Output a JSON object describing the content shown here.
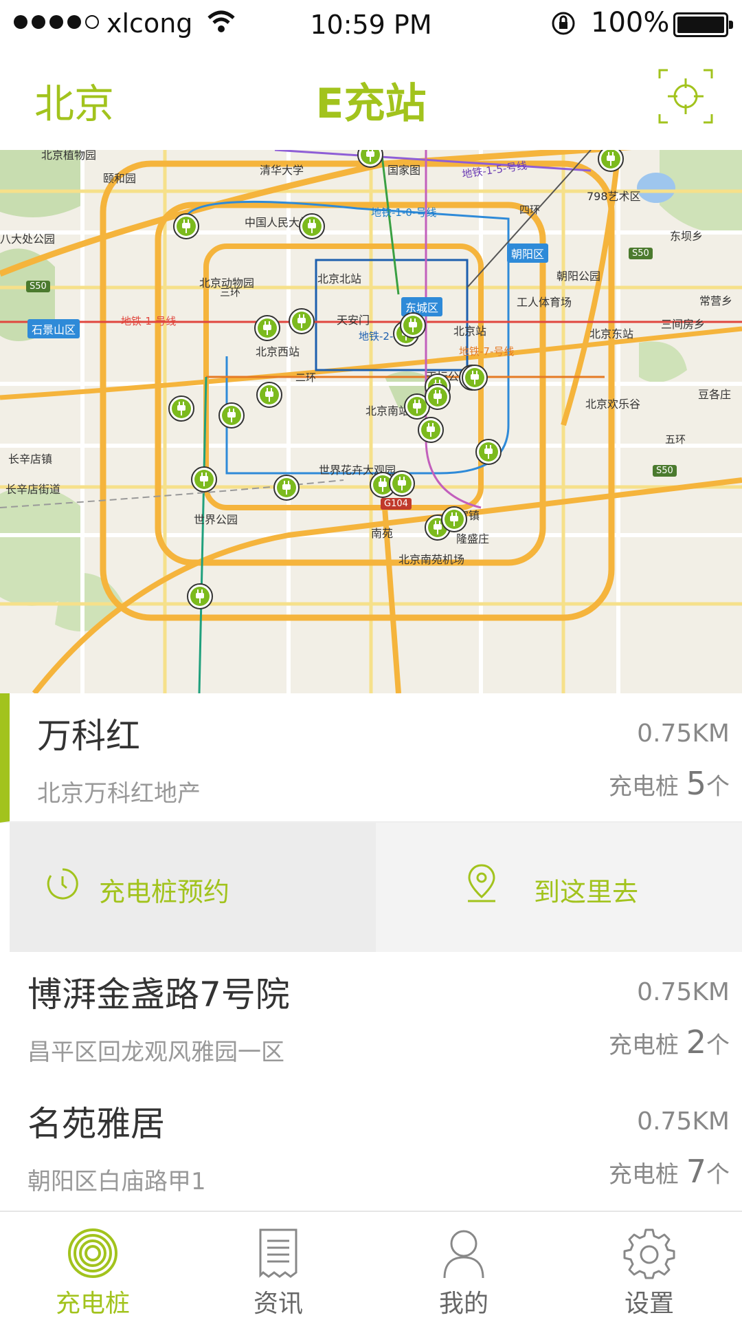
{
  "status_bar": {
    "carrier": "xlcong",
    "time": "10:59 PM",
    "battery_pct": "100%"
  },
  "header": {
    "city": "北京",
    "title": "E充站"
  },
  "map": {
    "labels": {
      "botanical": "北京植物园",
      "qinghua": "清华大学",
      "guojiatu": "国家图",
      "line15": "地铁-1-5-号线",
      "line10": "地铁-1-0-号线",
      "yiheyuan": "颐和园",
      "renmin": "中国人民大学",
      "art798": "798艺术区",
      "dongfeng": "东坝乡",
      "chaoyangqu": "朝阳区",
      "chaoyangpark": "朝阳公园",
      "s50a": "S50",
      "s50b": "S50",
      "s50c": "S50",
      "zoo": "北京动物园",
      "beijingbei": "北京北站",
      "dongchengqu": "东城区",
      "gongti": "工人体育场",
      "changying": "常营乡",
      "badachu": "八大处公园",
      "shijingshan": "石景山区",
      "line1": "地铁-1-号线",
      "tiananmen": "天安门",
      "beijingzhan": "北京站",
      "line2": "地铁-2-号线",
      "sanjianfang": "三间房乡",
      "beijingxi": "北京西站",
      "beijingdong": "北京东站",
      "line7": "地铁-7-号线",
      "tiantan": "天坛公园",
      "beijingnan": "北京南站",
      "huanlegu": "北京欢乐谷",
      "dougezhuang": "豆各庄",
      "changxindian": "长辛店镇",
      "changxindianjie": "长辛店街道",
      "shijiehuahui": "世界花卉大观园",
      "shijiepark": "世界公园",
      "g104": "G104",
      "jiugong": "旧宫镇",
      "nanyuan": "南苑",
      "longshengzhuang": "隆盛庄",
      "nanyuanairport": "北京南苑机场",
      "sihuan": "四环",
      "wuhuan": "五环",
      "erhuan": "二环",
      "sanhuan": "三环"
    }
  },
  "stations": [
    {
      "name": "万科红",
      "address": "北京万科红地产",
      "distance": "0.75KM",
      "pile_label": "充电桩",
      "count": "5",
      "unit": "个"
    },
    {
      "name": "博湃金盏路7号院",
      "address": "昌平区回龙观风雅园一区",
      "distance": "0.75KM",
      "pile_label": "充电桩",
      "count": "2",
      "unit": "个"
    },
    {
      "name": "名苑雅居",
      "address": "朝阳区白庙路甲1",
      "distance": "0.75KM",
      "pile_label": "充电桩",
      "count": "7",
      "unit": "个"
    }
  ],
  "actions": {
    "reserve": "充电桩预约",
    "navigate": "到这里去"
  },
  "tabbar": {
    "tabs": [
      {
        "label": "充电桩",
        "icon": "charging-pile-icon"
      },
      {
        "label": "资讯",
        "icon": "news-icon"
      },
      {
        "label": "我的",
        "icon": "user-icon"
      },
      {
        "label": "设置",
        "icon": "gear-icon"
      }
    ]
  },
  "colors": {
    "accent": "#a2c31d",
    "metro_blue": "#2e8ad8",
    "marker_green": "#7cba1e",
    "highway_orange": "#f5b43c"
  }
}
